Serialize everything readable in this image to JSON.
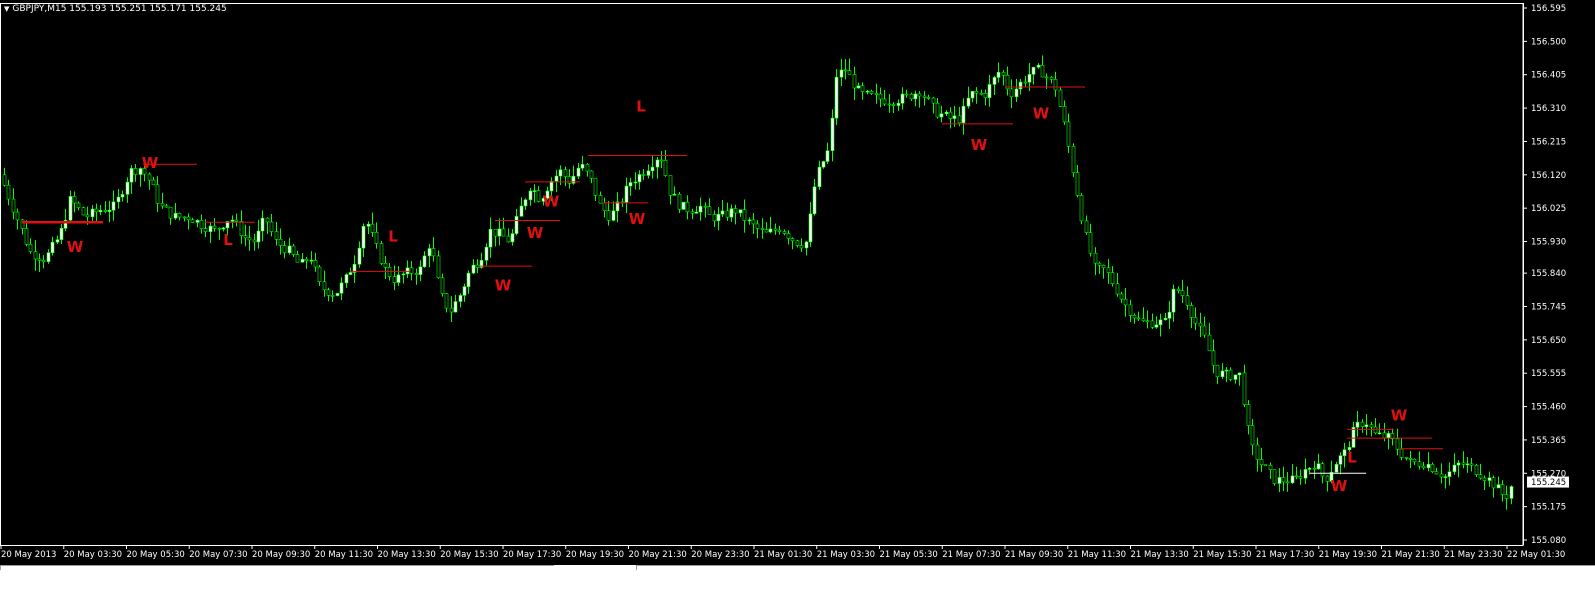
{
  "header": {
    "symbol_line": "GBPJPY,M15  155.193 155.251 155.171 155.245",
    "dropdown_glyph": "▼"
  },
  "chart_data": {
    "type": "candlestick",
    "symbol": "GBPJPY",
    "timeframe": "M15",
    "ohlc_current": {
      "open": 155.193,
      "high": 155.251,
      "low": 155.171,
      "close": 155.245
    },
    "current_price_label": "155.245",
    "ylim": [
      155.08,
      156.595
    ],
    "y_ticks": [
      "156.595",
      "156.500",
      "156.405",
      "156.310",
      "156.215",
      "156.120",
      "156.025",
      "155.930",
      "155.840",
      "155.745",
      "155.650",
      "155.555",
      "155.460",
      "155.365",
      "155.270",
      "155.175",
      "155.080"
    ],
    "x_ticks": [
      "20 May 2013",
      "20 May 03:30",
      "20 May 05:30",
      "20 May 07:30",
      "20 May 09:30",
      "20 May 11:30",
      "20 May 13:30",
      "20 May 15:30",
      "20 May 17:30",
      "20 May 19:30",
      "20 May 21:30",
      "20 May 23:30",
      "21 May 01:30",
      "21 May 03:30",
      "21 May 05:30",
      "21 May 07:30",
      "21 May 09:30",
      "21 May 11:30",
      "21 May 13:30",
      "21 May 15:30",
      "21 May 17:30",
      "21 May 19:30",
      "21 May 21:30",
      "21 May 23:30",
      "22 May 01:30"
    ],
    "close_path": [
      [
        0,
        156.12
      ],
      [
        15,
        156.01
      ],
      [
        30,
        155.9
      ],
      [
        45,
        155.88
      ],
      [
        60,
        155.95
      ],
      [
        70,
        156.05
      ],
      [
        85,
        156.0
      ],
      [
        100,
        156.02
      ],
      [
        115,
        156.03
      ],
      [
        130,
        156.13
      ],
      [
        140,
        156.14
      ],
      [
        150,
        156.1
      ],
      [
        160,
        156.03
      ],
      [
        175,
        156.0
      ],
      [
        190,
        156.0
      ],
      [
        200,
        155.98
      ],
      [
        215,
        155.96
      ],
      [
        230,
        156.0
      ],
      [
        245,
        155.94
      ],
      [
        255,
        155.93
      ],
      [
        265,
        156.0
      ],
      [
        275,
        155.93
      ],
      [
        290,
        155.9
      ],
      [
        300,
        155.86
      ],
      [
        310,
        155.89
      ],
      [
        320,
        155.8
      ],
      [
        335,
        155.78
      ],
      [
        345,
        155.82
      ],
      [
        355,
        155.88
      ],
      [
        365,
        156.0
      ],
      [
        375,
        155.92
      ],
      [
        385,
        155.85
      ],
      [
        395,
        155.82
      ],
      [
        405,
        155.84
      ],
      [
        420,
        155.85
      ],
      [
        430,
        155.93
      ],
      [
        440,
        155.78
      ],
      [
        450,
        155.73
      ],
      [
        460,
        155.78
      ],
      [
        470,
        155.85
      ],
      [
        480,
        155.88
      ],
      [
        490,
        155.96
      ],
      [
        500,
        155.95
      ],
      [
        510,
        155.93
      ],
      [
        520,
        156.02
      ],
      [
        530,
        156.09
      ],
      [
        540,
        156.05
      ],
      [
        550,
        156.1
      ],
      [
        560,
        156.13
      ],
      [
        570,
        156.1
      ],
      [
        580,
        156.15
      ],
      [
        590,
        156.11
      ],
      [
        600,
        156.03
      ],
      [
        610,
        156.0
      ],
      [
        620,
        156.04
      ],
      [
        630,
        156.1
      ],
      [
        640,
        156.12
      ],
      [
        650,
        156.15
      ],
      [
        660,
        156.18
      ],
      [
        670,
        156.07
      ],
      [
        680,
        156.03
      ],
      [
        690,
        156.02
      ],
      [
        700,
        156.03
      ],
      [
        710,
        156.0
      ],
      [
        720,
        156.0
      ],
      [
        735,
        156.02
      ],
      [
        750,
        155.98
      ],
      [
        765,
        155.95
      ],
      [
        780,
        155.97
      ],
      [
        795,
        155.93
      ],
      [
        805,
        155.92
      ],
      [
        810,
        156.0
      ],
      [
        815,
        156.1
      ],
      [
        820,
        156.14
      ],
      [
        830,
        156.2
      ],
      [
        835,
        156.4
      ],
      [
        845,
        156.42
      ],
      [
        860,
        156.35
      ],
      [
        875,
        156.34
      ],
      [
        890,
        156.33
      ],
      [
        905,
        156.34
      ],
      [
        920,
        156.36
      ],
      [
        935,
        156.3
      ],
      [
        950,
        156.28
      ],
      [
        960,
        156.28
      ],
      [
        970,
        156.35
      ],
      [
        985,
        156.35
      ],
      [
        1000,
        156.42
      ],
      [
        1010,
        156.35
      ],
      [
        1020,
        156.38
      ],
      [
        1030,
        156.41
      ],
      [
        1040,
        156.42
      ],
      [
        1055,
        156.37
      ],
      [
        1065,
        156.25
      ],
      [
        1075,
        156.1
      ],
      [
        1085,
        155.95
      ],
      [
        1095,
        155.85
      ],
      [
        1105,
        155.85
      ],
      [
        1115,
        155.8
      ],
      [
        1125,
        155.75
      ],
      [
        1140,
        155.7
      ],
      [
        1155,
        155.7
      ],
      [
        1165,
        155.7
      ],
      [
        1175,
        155.8
      ],
      [
        1185,
        155.77
      ],
      [
        1195,
        155.7
      ],
      [
        1205,
        155.65
      ],
      [
        1215,
        155.56
      ],
      [
        1225,
        155.55
      ],
      [
        1240,
        155.55
      ],
      [
        1250,
        155.35
      ],
      [
        1260,
        155.3
      ],
      [
        1275,
        155.25
      ],
      [
        1285,
        155.25
      ],
      [
        1295,
        155.25
      ],
      [
        1305,
        155.28
      ],
      [
        1315,
        155.3
      ],
      [
        1325,
        155.25
      ],
      [
        1335,
        155.3
      ],
      [
        1345,
        155.33
      ],
      [
        1355,
        155.4
      ],
      [
        1365,
        155.42
      ],
      [
        1375,
        155.38
      ],
      [
        1390,
        155.37
      ],
      [
        1400,
        155.33
      ],
      [
        1410,
        155.3
      ],
      [
        1425,
        155.3
      ],
      [
        1435,
        155.28
      ],
      [
        1445,
        155.26
      ],
      [
        1460,
        155.3
      ],
      [
        1475,
        155.28
      ],
      [
        1490,
        155.25
      ],
      [
        1505,
        155.2
      ],
      [
        1512,
        155.24
      ]
    ],
    "markers": [
      {
        "label": "W",
        "x": 75,
        "y": 155.9
      },
      {
        "label": "W",
        "x": 150,
        "y": 156.14
      },
      {
        "label": "L",
        "x": 228,
        "y": 155.92
      },
      {
        "label": "L",
        "x": 393,
        "y": 155.93
      },
      {
        "label": "W",
        "x": 503,
        "y": 155.79
      },
      {
        "label": "W",
        "x": 535,
        "y": 155.94
      },
      {
        "label": "W",
        "x": 551,
        "y": 156.03
      },
      {
        "label": "W",
        "x": 637,
        "y": 155.98
      },
      {
        "label": "L",
        "x": 641,
        "y": 156.3
      },
      {
        "label": "W",
        "x": 979,
        "y": 156.19
      },
      {
        "label": "W",
        "x": 1041,
        "y": 156.28
      },
      {
        "label": "W",
        "x": 1339,
        "y": 155.22
      },
      {
        "label": "L",
        "x": 1352,
        "y": 155.3
      },
      {
        "label": "W",
        "x": 1399,
        "y": 155.42
      }
    ],
    "levels": [
      {
        "x1": 22,
        "x2": 103,
        "y": 155.985,
        "color": "#e01010"
      },
      {
        "x1": 143,
        "x2": 197,
        "y": 156.15,
        "color": "#e01010"
      },
      {
        "x1": 205,
        "x2": 255,
        "y": 155.985,
        "color": "#e01010"
      },
      {
        "x1": 350,
        "x2": 410,
        "y": 155.845,
        "color": "#e01010"
      },
      {
        "x1": 480,
        "x2": 532,
        "y": 155.86,
        "color": "#e01010"
      },
      {
        "x1": 495,
        "x2": 560,
        "y": 155.99,
        "color": "#e01010"
      },
      {
        "x1": 525,
        "x2": 580,
        "y": 156.1,
        "color": "#e01010"
      },
      {
        "x1": 588,
        "x2": 687,
        "y": 156.175,
        "color": "#e01010"
      },
      {
        "x1": 603,
        "x2": 648,
        "y": 156.04,
        "color": "#e01010"
      },
      {
        "x1": 942,
        "x2": 1013,
        "y": 156.265,
        "color": "#e01010"
      },
      {
        "x1": 1005,
        "x2": 1085,
        "y": 156.37,
        "color": "#e01010"
      },
      {
        "x1": 1310,
        "x2": 1366,
        "y": 155.27,
        "color": "#ffffff"
      },
      {
        "x1": 1347,
        "x2": 1394,
        "y": 155.395,
        "color": "#e01010"
      },
      {
        "x1": 1347,
        "x2": 1432,
        "y": 155.37,
        "color": "#e01010"
      },
      {
        "x1": 1400,
        "x2": 1443,
        "y": 155.34,
        "color": "#e01010"
      }
    ],
    "colors": {
      "background": "#000000",
      "bull_body": "#ffffff",
      "bear_body": "#000000",
      "wick": "#00ff00",
      "grid_text": "#ffffff",
      "marker": "#e01010",
      "axis": "#ffffff"
    }
  }
}
